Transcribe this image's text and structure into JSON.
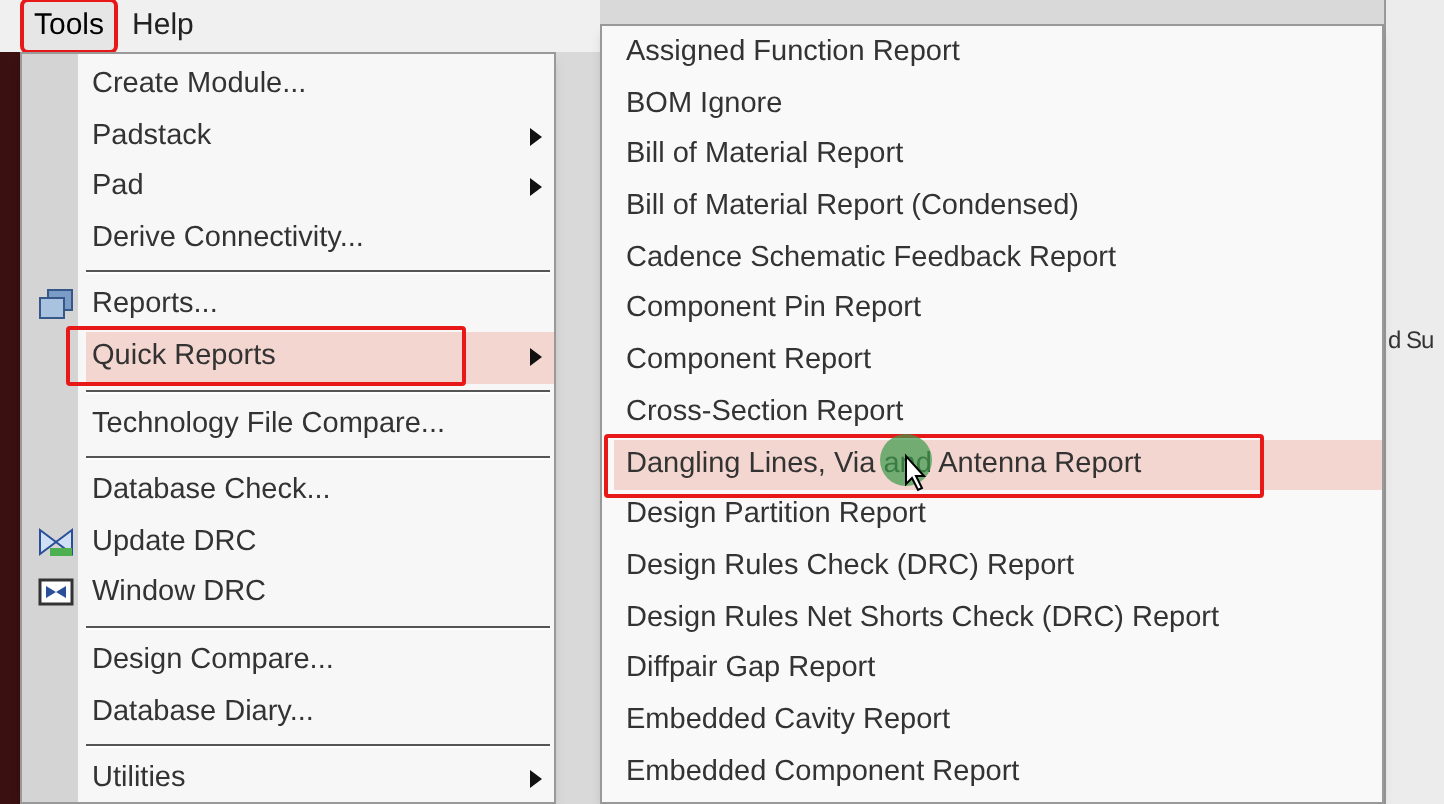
{
  "menubar": [
    {
      "label": "Tools",
      "selected": true,
      "annotated": true
    },
    {
      "label": "Help",
      "selected": false,
      "annotated": false
    }
  ],
  "tools_menu": [
    {
      "kind": "item",
      "label": "Create Module...",
      "submenu": false,
      "icon": false,
      "selected": false,
      "annotated": false
    },
    {
      "kind": "item",
      "label": "Padstack",
      "submenu": true,
      "icon": false,
      "selected": false,
      "annotated": false
    },
    {
      "kind": "item",
      "label": "Pad",
      "submenu": true,
      "icon": false,
      "selected": false,
      "annotated": false
    },
    {
      "kind": "item",
      "label": "Derive Connectivity...",
      "submenu": false,
      "icon": false,
      "selected": false,
      "annotated": false
    },
    {
      "kind": "separator"
    },
    {
      "kind": "item",
      "label": "Reports...",
      "submenu": false,
      "icon": true,
      "selected": false,
      "annotated": false
    },
    {
      "kind": "item",
      "label": "Quick Reports",
      "submenu": true,
      "icon": false,
      "selected": true,
      "annotated": true
    },
    {
      "kind": "separator"
    },
    {
      "kind": "item",
      "label": "Technology File Compare...",
      "submenu": false,
      "icon": false,
      "selected": false,
      "annotated": false
    },
    {
      "kind": "separator"
    },
    {
      "kind": "item",
      "label": "Database Check...",
      "submenu": false,
      "icon": false,
      "selected": false,
      "annotated": false
    },
    {
      "kind": "item",
      "label": "Update DRC",
      "submenu": false,
      "icon": true,
      "selected": false,
      "annotated": false
    },
    {
      "kind": "item",
      "label": "Window DRC",
      "submenu": false,
      "icon": true,
      "selected": false,
      "annotated": false
    },
    {
      "kind": "separator"
    },
    {
      "kind": "item",
      "label": "Design Compare...",
      "submenu": false,
      "icon": false,
      "selected": false,
      "annotated": false
    },
    {
      "kind": "item",
      "label": "Database Diary...",
      "submenu": false,
      "icon": false,
      "selected": false,
      "annotated": false
    },
    {
      "kind": "separator"
    },
    {
      "kind": "item",
      "label": "Utilities",
      "submenu": true,
      "icon": false,
      "selected": false,
      "annotated": false
    }
  ],
  "quick_reports_menu": [
    {
      "label": "Assigned Function Report",
      "selected": false,
      "annotated": false
    },
    {
      "label": "BOM Ignore",
      "selected": false,
      "annotated": false
    },
    {
      "label": "Bill of Material Report",
      "selected": false,
      "annotated": false
    },
    {
      "label": "Bill of Material Report (Condensed)",
      "selected": false,
      "annotated": false
    },
    {
      "label": "Cadence Schematic Feedback Report",
      "selected": false,
      "annotated": false
    },
    {
      "label": "Component Pin Report",
      "selected": false,
      "annotated": false
    },
    {
      "label": "Component Report",
      "selected": false,
      "annotated": false
    },
    {
      "label": "Cross-Section Report",
      "selected": false,
      "annotated": false
    },
    {
      "label": "Dangling Lines, Via and Antenna Report",
      "selected": true,
      "annotated": true
    },
    {
      "label": "Design Partition Report",
      "selected": false,
      "annotated": false
    },
    {
      "label": "Design Rules Check (DRC) Report",
      "selected": false,
      "annotated": false
    },
    {
      "label": "Design Rules Net Shorts Check (DRC) Report",
      "selected": false,
      "annotated": false
    },
    {
      "label": "Diffpair Gap Report",
      "selected": false,
      "annotated": false
    },
    {
      "label": "Embedded Cavity Report",
      "selected": false,
      "annotated": false
    },
    {
      "label": "Embedded Component Report",
      "selected": false,
      "annotated": false
    }
  ],
  "background_text": "d Su"
}
